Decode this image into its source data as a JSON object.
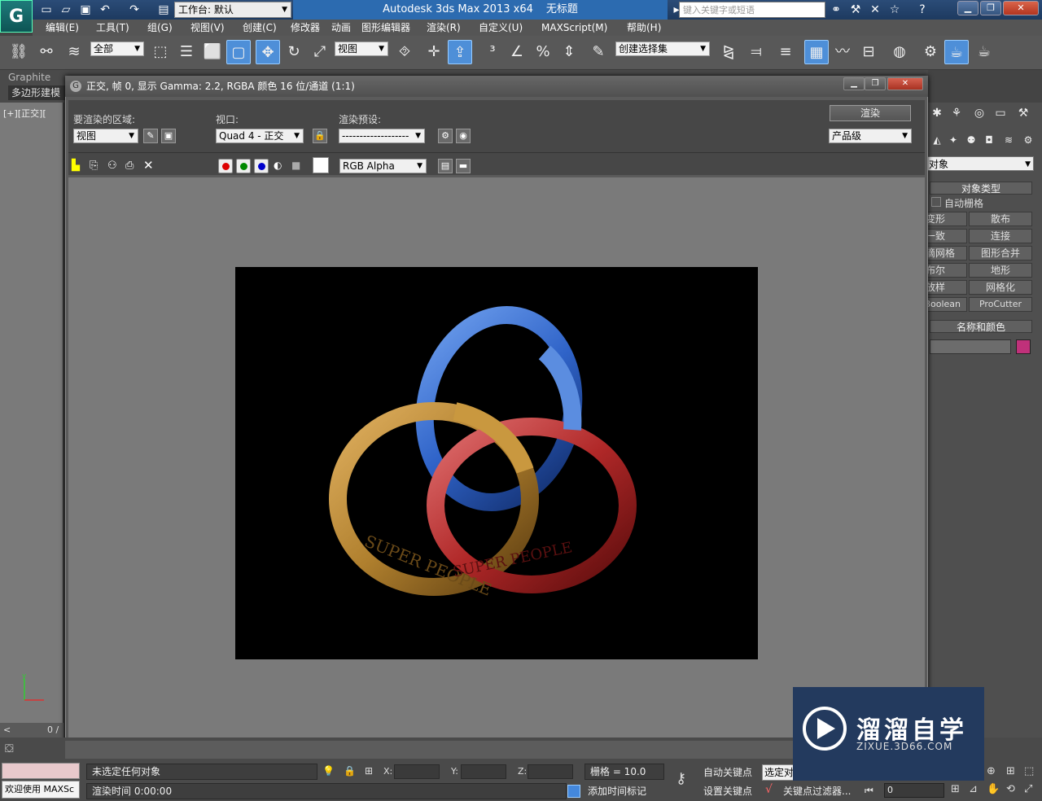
{
  "app": {
    "title": "Autodesk 3ds Max  2013 x64",
    "doc_name": "无标题",
    "workspace": "工作台: 默认",
    "search_placeholder": "键入关键字或短语"
  },
  "menu": [
    "编辑(E)",
    "工具(T)",
    "组(G)",
    "视图(V)",
    "创建(C)",
    "修改器",
    "动画",
    "图形编辑器",
    "渲染(R)",
    "自定义(U)",
    "MAXScript(M)",
    "帮助(H)"
  ],
  "toolbar": {
    "filter": "全部",
    "ref_coord": "视图",
    "selection_set": "创建选择集"
  },
  "ribbon": {
    "tab": "Graphite",
    "panel_label": "多边形建模"
  },
  "viewport": {
    "label": "[+][正交][",
    "frame_counter": "0 /"
  },
  "render_window": {
    "title": "正交, 帧 0, 显示 Gamma: 2.2, RGBA 颜色 16 位/通道 (1:1)",
    "area_label": "要渲染的区域:",
    "area_value": "视图",
    "viewport_label": "视口:",
    "viewport_value": "Quad 4 - 正交",
    "preset_label": "渲染预设:",
    "preset_value": "-------------------",
    "render_button": "渲染",
    "quality": "产品级",
    "channel": "RGB Alpha",
    "ring_text": "SUPER PEOPLE"
  },
  "command_panel": {
    "dropdown": "对象",
    "object_type_header": "对象类型",
    "auto_grid": "自动栅格",
    "buttons": [
      [
        "变形",
        "散布"
      ],
      [
        "一致",
        "连接"
      ],
      [
        "水滴网格",
        "图形合并"
      ],
      [
        "布尔",
        "地形"
      ],
      [
        "放样",
        "网格化"
      ],
      [
        "ProBoolean",
        "ProCutter"
      ]
    ],
    "name_color_header": "名称和颜色",
    "color": "#c0317a"
  },
  "status": {
    "selection": "未选定任何对象",
    "render_time": "渲染时间  0:00:00",
    "welcome": "欢迎使用 MAXSc",
    "x_label": "X:",
    "y_label": "Y:",
    "z_label": "Z:",
    "grid": "栅格 = 10.0",
    "add_time_tag": "添加时间标记",
    "auto_key": "自动关键点",
    "set_key": "设置关键点",
    "selected_obj": "选定对",
    "key_filter": "关键点过滤器...",
    "frame": "0"
  },
  "watermark": {
    "title": "溜溜自学",
    "subtitle": "ZIXUE.3D66.COM"
  },
  "colors": {
    "ring_gold": "#b0802e",
    "ring_blue": "#2f63c8",
    "ring_red": "#b02828"
  }
}
